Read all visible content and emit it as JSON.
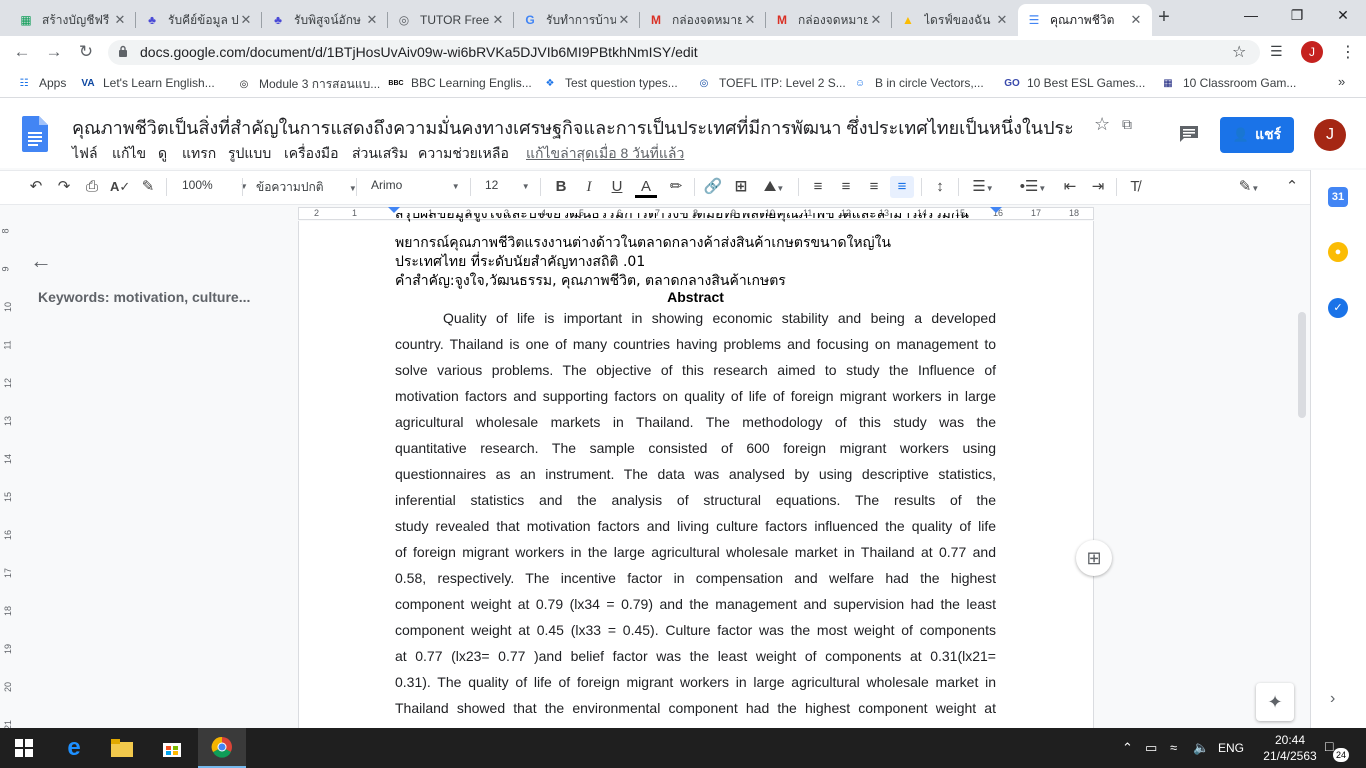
{
  "browser": {
    "tabs": [
      {
        "title": "สร้างบัญชีฟรี",
        "icon": "excel-icon",
        "color": "#0f9d58"
      },
      {
        "title": "รับคีย์ข้อมูล ป",
        "icon": "fastwork-icon",
        "color": "#4a4ad6"
      },
      {
        "title": "รับพิสูจน์อักษ",
        "icon": "fastwork-icon",
        "color": "#4a4ad6"
      },
      {
        "title": "TUTOR Free",
        "icon": "globe-icon",
        "color": "#5f6368"
      },
      {
        "title": "รับทำการบ้าน",
        "icon": "google-icon",
        "color": "#4285f4"
      },
      {
        "title": "กล่องจดหมาย",
        "icon": "gmail-icon",
        "color": "#d93025"
      },
      {
        "title": "กล่องจดหมาย",
        "icon": "gmail-icon",
        "color": "#d93025"
      },
      {
        "title": "ไดรฟ์ของฉัน",
        "icon": "drive-icon",
        "color": "#fbbc04"
      },
      {
        "title": "คุณภาพชีวิต",
        "icon": "docs-icon",
        "color": "#4285f4"
      }
    ],
    "url": "docs.google.com/document/d/1BTjHosUvAiv09w-wi6bRVKa5DJVIb6MI9PBtkhNmISY/edit",
    "profile_initial": "J",
    "bookmarks": [
      {
        "label": "Apps",
        "icon": "apps-grid-icon"
      },
      {
        "label": "Let's Learn English...",
        "icon": "voa-icon"
      },
      {
        "label": "Module 3 การสอนแบ...",
        "icon": "globe-icon"
      },
      {
        "label": "BBC Learning Englis...",
        "icon": "bbc-icon"
      },
      {
        "label": "Test question types...",
        "icon": "dots-icon"
      },
      {
        "label": "TOEFL ITP: Level 2 S...",
        "icon": "toefl-icon"
      },
      {
        "label": "B in circle Vectors,...",
        "icon": "robot-icon"
      },
      {
        "label": "10 Best ESL Games...",
        "icon": "go-icon"
      },
      {
        "label": "10 Classroom Gam...",
        "icon": "grid-icon"
      }
    ]
  },
  "docs": {
    "title": "คุณภาพชีวิตเป็นสิ่งที่สำคัญในการแสดงถึงความมั่นคงทางเศรษฐกิจและการเป็นประเทศที่มีการพัฒนา ซึ่งประเทศไทยเป็นหนึ่งในประเทศ...",
    "menus": [
      "ไฟล์",
      "แก้ไข",
      "ดู",
      "แทรก",
      "รูปแบบ",
      "เครื่องมือ",
      "ส่วนเสริม",
      "ความช่วยเหลือ"
    ],
    "last_edit": "แก้ไขล่าสุดเมื่อ 8 วันที่แล้ว",
    "share_label": "แชร์",
    "user_initial": "J",
    "zoom": "100%",
    "style": "ข้อความปกติ",
    "font": "Arimo",
    "font_size": "12"
  },
  "ruler": {
    "top_numbers": [
      "2",
      "1",
      "1",
      "2",
      "3",
      "4",
      "5",
      "6",
      "7",
      "8",
      "9",
      "10",
      "11",
      "12",
      "13",
      "14",
      "15",
      "16",
      "17",
      "18"
    ],
    "left_numbers": [
      "8",
      "9",
      "10",
      "11",
      "12",
      "13",
      "14",
      "15",
      "16",
      "17",
      "18",
      "19",
      "20",
      "21"
    ]
  },
  "outline": {
    "heading": "Keywords: motivation, culture..."
  },
  "document": {
    "thai_lines": [
      "สรุปผลข้อมูลจูงใจและปัจจัยวัฒนธรรมการดำรงชีวิตมีอิทธิพลต่อคุณภาพชีวิตและสามารถร่วมกัน",
      "พยากรณ์คุณภาพชีวิตแรงงานต่างด้าวในตลาดกลางค้าส่งสินค้าเกษตรขนาดใหญ่ใน",
      "ประเทศไทย ที่ระดับนัยสำคัญทางสถิติ .01",
      "คำสำคัญ:จูงใจ,วัฒนธรรม, คุณภาพชีวิต, ตลาดกลางสินค้าเกษตร"
    ],
    "abstract_heading": "Abstract",
    "abstract_lines": [
      "Quality of life is important in showing economic stability and being a developed",
      "country. Thailand is one of many countries having problems and focusing on management to",
      "solve various problems. The objective of this research aimed to study the Influence of",
      "motivation factors and supporting factors on quality of life of foreign migrant workers in large",
      "agricultural wholesale markets in Thailand. The methodology of this study was the",
      "quantitative research. The sample consisted of 600 foreign migrant workers using",
      "questionnaires as an instrument. The data was analysed by using descriptive statistics,",
      "inferential statistics and the analysis of structural equations. The results of the",
      "study revealed that motivation factors and living culture factors influenced the quality of life",
      "of foreign migrant workers in the large agricultural wholesale market in Thailand at 0.77 and",
      "0.58, respectively. The incentive factor in compensation and welfare had the highest",
      "component weight at 0.79 (lx34 = 0.79) and the management and supervision had the least",
      "component weight at 0.45 (lx33 = 0.45). Culture factor was the most weight of components",
      "at 0.77 (lx23= 0.77 )and belief factor  was the least weight of components at 0.31(lx21=",
      "0.31). The quality of life of foreign migrant workers in large agricultural wholesale market in",
      "Thailand showed that the environmental component had the highest component weight at"
    ]
  },
  "taskbar": {
    "time": "20:44",
    "date": "21/4/2563",
    "language": "ENG",
    "notification_count": "24"
  }
}
